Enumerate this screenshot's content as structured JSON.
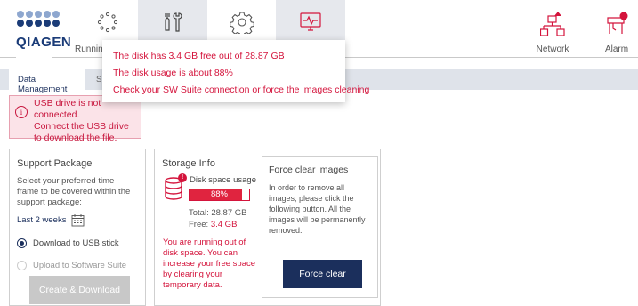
{
  "header": {
    "logo_text": "QIAGEN",
    "running_label": "Runnin",
    "nav": [
      {
        "name": "running-icon",
        "active": false
      },
      {
        "name": "tools-icon",
        "active": true
      },
      {
        "name": "settings-gear-icon",
        "active": false
      },
      {
        "name": "monitor-icon",
        "active": true
      }
    ],
    "network_label": "Network",
    "alarm_label": "Alarm"
  },
  "tooltip": {
    "line1": "The disk has 3.4 GB free out of 28.87 GB",
    "line2": "The disk usage is about 88%",
    "line3": "Check your SW Suite connection or force the images cleaning"
  },
  "tabs": {
    "data_management": "Data Management",
    "second": "S"
  },
  "usb_warning": {
    "line1": "USB drive is not connected.",
    "line2": "Connect the USB drive",
    "line3": "to download the file."
  },
  "support_package": {
    "title": "Support Package",
    "description": "Select your preferred time frame to be covered within the support package:",
    "period": "Last 2 weeks",
    "option_usb": "Download to USB stick",
    "option_usb_selected": true,
    "option_suite": "Upload to Software Suite",
    "button": "Create & Download"
  },
  "storage_info": {
    "title": "Storage Info",
    "usage_label": "Disk space usage",
    "usage_percent": 88,
    "usage_text": "88%",
    "total": "Total: 28.87 GB",
    "free_label": "Free:",
    "free_value": "3.4 GB",
    "warning": "You are running out of disk space. You can increase your free space by clearing your temporary data."
  },
  "force_clear": {
    "title": "Force clear images",
    "description": "In order to remove all images, please click the following button. All the images will be permanently removed.",
    "button": "Force clear"
  },
  "colors": {
    "brand_blue": "#1b3c78",
    "alert_red": "#d4143c",
    "button_navy": "#1b2f5c"
  }
}
